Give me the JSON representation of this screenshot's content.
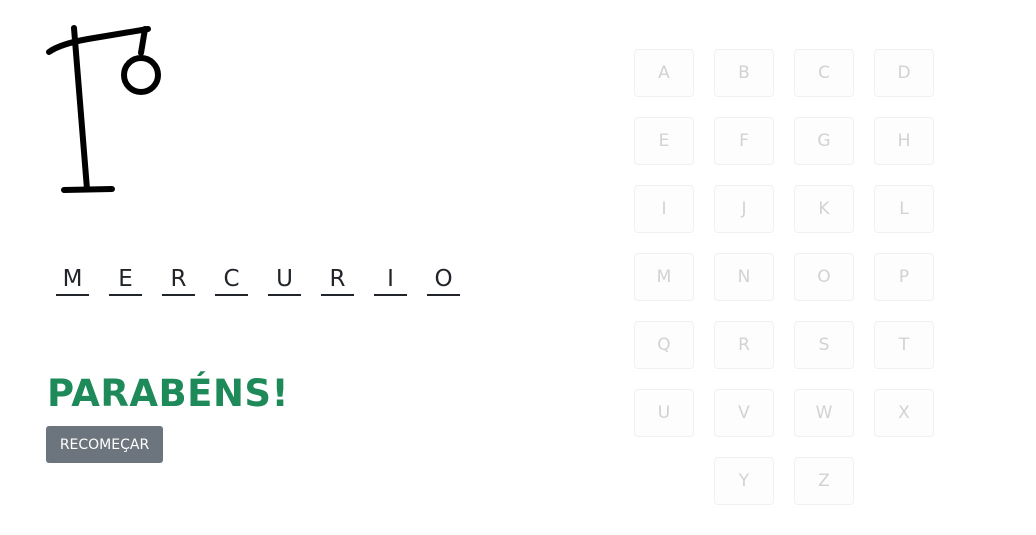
{
  "word": {
    "letters": [
      "M",
      "E",
      "R",
      "C",
      "U",
      "R",
      "I",
      "O"
    ]
  },
  "result": {
    "message": "PARABÉNS!",
    "color": "#1e8a5a"
  },
  "restart": {
    "label": "RECOMEÇAR"
  },
  "keyboard": {
    "keys": [
      "A",
      "B",
      "C",
      "D",
      "E",
      "F",
      "G",
      "H",
      "I",
      "J",
      "K",
      "L",
      "M",
      "N",
      "O",
      "P",
      "Q",
      "R",
      "S",
      "T",
      "U",
      "V",
      "W",
      "X",
      "Y",
      "Z"
    ],
    "state": "disabled"
  },
  "gallows": {
    "icon": "gallows-icon",
    "errors": 0
  }
}
